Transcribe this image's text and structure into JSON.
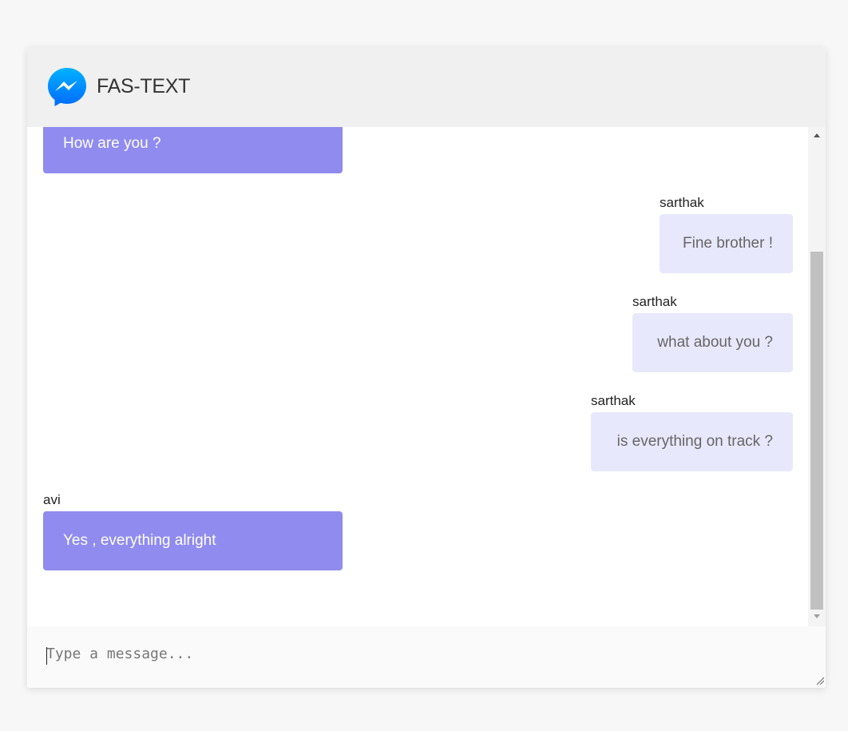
{
  "app": {
    "title": "FAS-TEXT",
    "logo_icon": "messenger-logo-icon",
    "brand_color": "#0a84ff"
  },
  "messages": [
    {
      "sender": "",
      "text": "How are you ?",
      "direction": "received"
    },
    {
      "sender": "sarthak",
      "text": "Fine brother !",
      "direction": "sent"
    },
    {
      "sender": "sarthak",
      "text": "what about you ?",
      "direction": "sent"
    },
    {
      "sender": "sarthak",
      "text": "is everything on track ?",
      "direction": "sent"
    },
    {
      "sender": "avi",
      "text": "Yes , everything alright",
      "direction": "received"
    }
  ],
  "composer": {
    "placeholder": "Type a message...",
    "value": ""
  },
  "colors": {
    "received_bubble": "#8f8bef",
    "sent_bubble": "#e8e8fc",
    "header_bg": "#f0f0f0"
  }
}
